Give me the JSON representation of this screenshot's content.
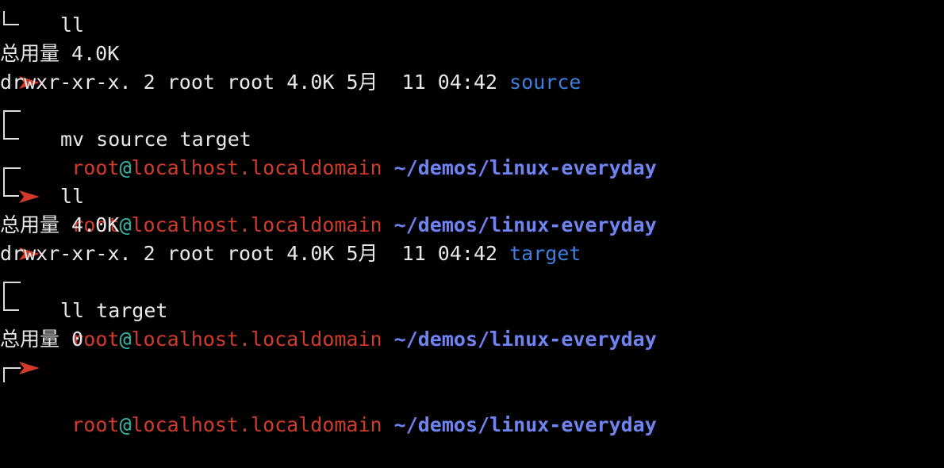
{
  "prompt": {
    "user": "root",
    "at": "@",
    "host": "localhost.localdomain",
    "path": "~/demos/linux-everyday"
  },
  "colors": {
    "background": "#000000",
    "user": "#d23a2a",
    "at": "#34b7a7",
    "path": "#6f84f0",
    "directory": "#3d7fe0",
    "arrow": "#d23a2a",
    "text": "#e8e8e8"
  },
  "lines": {
    "l1_cmd": "ll",
    "l2_total": "总用量 4.0K",
    "l3_perm": "drwxr-xr-x. 2 root root 4.0K 5月  11 04:42",
    "l3_name": "source",
    "l5_cmd": "mv source target",
    "l7_cmd": "ll",
    "l8_total": "总用量 4.0K",
    "l9_perm": "drwxr-xr-x. 2 root root 4.0K 5月  11 04:42",
    "l9_name": "target",
    "l11_cmd": "ll target",
    "l12_total": "总用量 0"
  }
}
